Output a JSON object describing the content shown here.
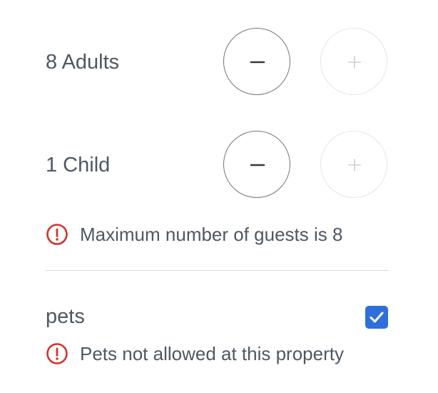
{
  "guests": {
    "adults": {
      "label": "8 Adults",
      "decrement_symbol": "−",
      "increment_symbol": "+",
      "decrement_enabled": true,
      "increment_enabled": false
    },
    "children": {
      "label": "1 Child",
      "decrement_symbol": "−",
      "increment_symbol": "+",
      "decrement_enabled": true,
      "increment_enabled": false
    },
    "max_guests_error": "Maximum number of guests is 8"
  },
  "pets": {
    "label": "pets",
    "checked": true,
    "error": "Pets not allowed at this property"
  },
  "colors": {
    "error_red": "#d0342c",
    "checkbox_blue": "#2f6fdb",
    "text": "#4d5862",
    "border_active": "#6e7780",
    "border_disabled": "#e3e5e7"
  }
}
